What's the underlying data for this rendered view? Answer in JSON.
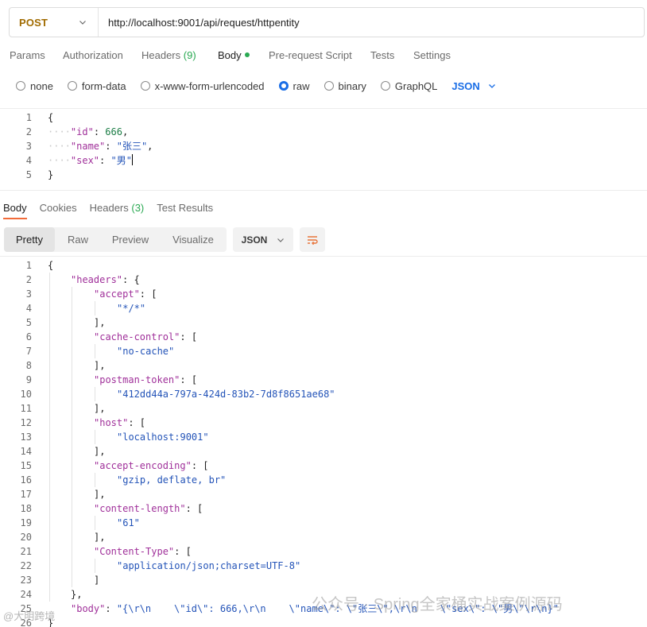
{
  "request": {
    "method": "POST",
    "url": "http://localhost:9001/api/request/httpentity"
  },
  "request_tabs": {
    "params": "Params",
    "authorization": "Authorization",
    "headers": "Headers",
    "headers_count": "(9)",
    "body": "Body",
    "pre_request": "Pre-request Script",
    "tests": "Tests",
    "settings": "Settings"
  },
  "body_types": {
    "none": "none",
    "form_data": "form-data",
    "urlencoded": "x-www-form-urlencoded",
    "raw": "raw",
    "binary": "binary",
    "graphql": "GraphQL",
    "selected": "raw",
    "language": "JSON"
  },
  "request_body": {
    "line_numbers": [
      "1",
      "2",
      "3",
      "4",
      "5"
    ],
    "l1": "{",
    "id_key": "\"id\"",
    "id_val": "666",
    "name_key": "\"name\"",
    "name_val": "\"张三\"",
    "sex_key": "\"sex\"",
    "sex_val": "\"男\"",
    "l5": "}"
  },
  "response_tabs": {
    "body": "Body",
    "cookies": "Cookies",
    "headers": "Headers",
    "headers_count": "(3)",
    "test_results": "Test Results"
  },
  "view_modes": {
    "pretty": "Pretty",
    "raw": "Raw",
    "preview": "Preview",
    "visualize": "Visualize",
    "format": "JSON"
  },
  "response_body": {
    "line_numbers": [
      "1",
      "2",
      "3",
      "4",
      "5",
      "6",
      "7",
      "8",
      "9",
      "10",
      "11",
      "12",
      "13",
      "14",
      "15",
      "16",
      "17",
      "18",
      "19",
      "20",
      "21",
      "22",
      "23",
      "24",
      "25",
      "26"
    ],
    "headers_key": "\"headers\"",
    "accept_key": "\"accept\"",
    "accept_val": "\"*/*\"",
    "cache_key": "\"cache-control\"",
    "cache_val": "\"no-cache\"",
    "token_key": "\"postman-token\"",
    "token_val": "\"412dd44a-797a-424d-83b2-7d8f8651ae68\"",
    "host_key": "\"host\"",
    "host_val": "\"localhost:9001\"",
    "enc_key": "\"accept-encoding\"",
    "enc_val": "\"gzip, deflate, br\"",
    "len_key": "\"content-length\"",
    "len_val": "\"61\"",
    "ctype_key": "\"Content-Type\"",
    "ctype_val": "\"application/json;charset=UTF-8\"",
    "body_key": "\"body\"",
    "body_val": "\"{\\r\\n    \\\"id\\\": 666,\\r\\n    \\\"name\\\": \\\"张三\\\",\\r\\n    \\\"sex\\\": \\\"男\\\"\\r\\n}\""
  },
  "watermark": {
    "text": "公众号 · Spring全家桶实战案例源码",
    "left_text": "@大明跨境"
  },
  "colors": {
    "method": "#a06b00",
    "accent": "#1a6ee6",
    "active_tab_underline": "#f26b3a",
    "dot": "#2aa952",
    "json_key": "#a0309a",
    "json_string": "#2454b8",
    "json_number": "#1c7d46"
  }
}
